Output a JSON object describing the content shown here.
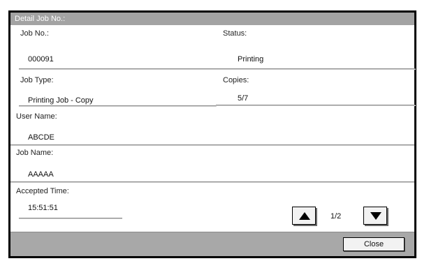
{
  "window": {
    "title": "Detail Job No.:"
  },
  "fields": {
    "job_no": {
      "label": "Job No.:",
      "value": "000091"
    },
    "status": {
      "label": "Status:",
      "value": "Printing"
    },
    "job_type": {
      "label": "Job Type:",
      "value": "Printing Job - Copy"
    },
    "copies": {
      "label": "Copies:",
      "value": "5/7"
    },
    "user_name": {
      "label": "User Name:",
      "value": "ABCDE"
    },
    "job_name": {
      "label": "Job Name:",
      "value": "AAAAA"
    },
    "accepted_time": {
      "label": "Accepted Time:",
      "value": "15:51:51"
    }
  },
  "pager": {
    "indicator": "1/2",
    "up_icon": "arrow-up-icon",
    "down_icon": "arrow-down-icon"
  },
  "buttons": {
    "close_label": "Close"
  },
  "colors": {
    "title_bar": "#a3a3a3",
    "bottom_bar": "#a8a8a8",
    "frame_border": "#000000"
  }
}
